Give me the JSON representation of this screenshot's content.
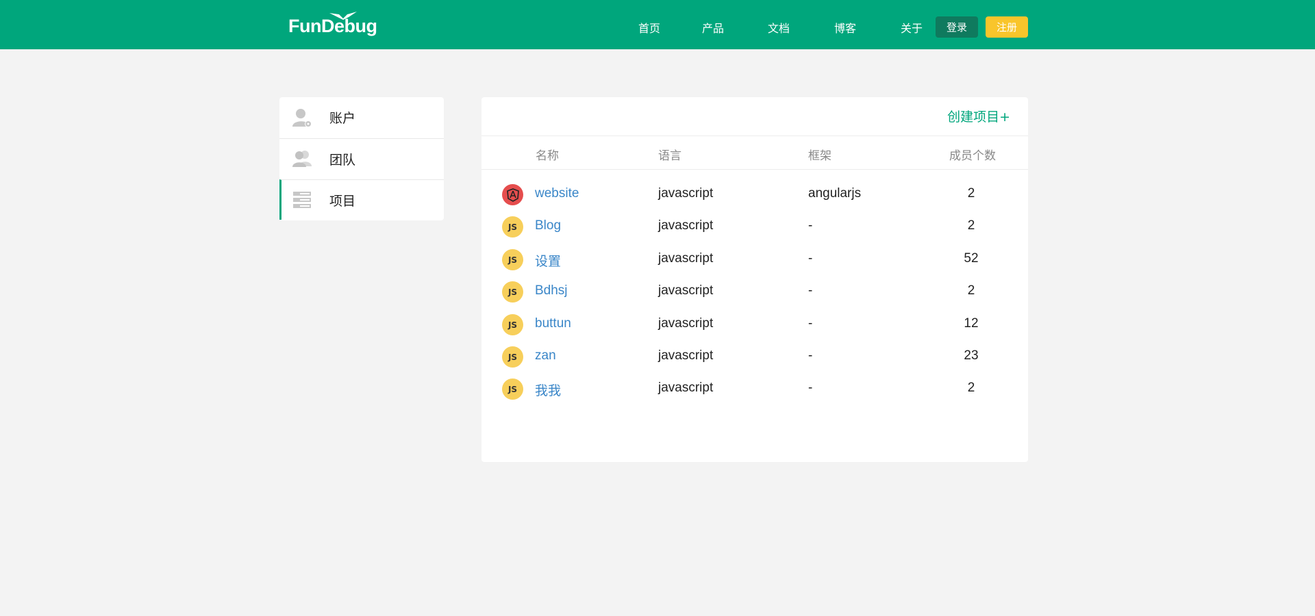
{
  "header": {
    "logo_text": "FunDebug",
    "nav": [
      "首页",
      "产品",
      "文档",
      "博客",
      "关于"
    ],
    "login_label": "登录",
    "register_label": "注册",
    "colors": {
      "brand": "#00a67c",
      "login_bg": "#0f7a5e",
      "register_bg": "#f9c52b"
    }
  },
  "sidebar": {
    "items": [
      {
        "label": "账户",
        "icon": "user-settings-icon"
      },
      {
        "label": "团队",
        "icon": "team-icon"
      },
      {
        "label": "项目",
        "icon": "project-list-icon",
        "active": true
      }
    ]
  },
  "main": {
    "create_label": "创建项目+",
    "columns": [
      "名称",
      "语言",
      "框架",
      "成员个数"
    ],
    "rows": [
      {
        "icon": "angular-icon",
        "name": "website",
        "language": "javascript",
        "framework": "angularjs",
        "members": "2"
      },
      {
        "icon": "js-icon",
        "name": "Blog",
        "language": "javascript",
        "framework": "-",
        "members": "2"
      },
      {
        "icon": "js-icon",
        "name": "设置",
        "language": "javascript",
        "framework": "-",
        "members": "52"
      },
      {
        "icon": "js-icon",
        "name": "Bdhsj",
        "language": "javascript",
        "framework": "-",
        "members": "2"
      },
      {
        "icon": "js-icon",
        "name": "buttun",
        "language": "javascript",
        "framework": "-",
        "members": "12"
      },
      {
        "icon": "js-icon",
        "name": "zan",
        "language": "javascript",
        "framework": "-",
        "members": "23"
      },
      {
        "icon": "js-icon",
        "name": "我我",
        "language": "javascript",
        "framework": "-",
        "members": "2"
      }
    ],
    "badge_text": "JS"
  }
}
